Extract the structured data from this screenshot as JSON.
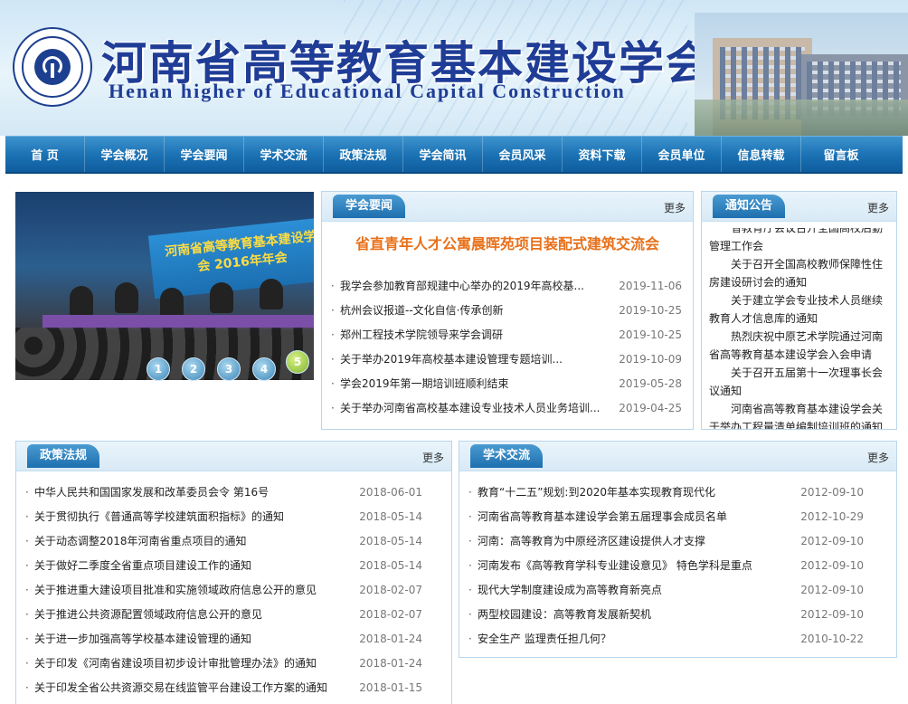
{
  "site": {
    "title": "河南省高等教育基本建设学会",
    "subtitle": "Henan higher of Educational Capital Construction"
  },
  "nav": [
    "首 页",
    "学会概况",
    "学会要闻",
    "学术交流",
    "政策法规",
    "学会简讯",
    "会员风采",
    "资料下载",
    "会员单位",
    "信息转载",
    "留言板"
  ],
  "slider": {
    "banner_text": "河南省高等教育基本建设学会 2016年年会",
    "dots": [
      "1",
      "2",
      "3",
      "4",
      "5"
    ],
    "active_dot": 5
  },
  "more_label": "更多",
  "news": {
    "title": "学会要闻",
    "headline": "省直青年人才公寓晨晖苑项目装配式建筑交流会",
    "items": [
      {
        "title": "我学会参加教育部规建中心举办的2019年高校基...",
        "date": "2019-11-06"
      },
      {
        "title": "杭州会议报道--文化自信·传承创新",
        "date": "2019-10-25"
      },
      {
        "title": "郑州工程技术学院领导来学会调研",
        "date": "2019-10-25"
      },
      {
        "title": "关于举办2019年高校基本建设管理专题培训...",
        "date": "2019-10-09"
      },
      {
        "title": "学会2019年第一期培训班顺利结束",
        "date": "2019-05-28"
      },
      {
        "title": "关于举办河南省高校基本建设专业技术人员业务培训...",
        "date": "2019-04-25"
      }
    ]
  },
  "notice": {
    "title": "通知公告",
    "items": [
      "省教育厅会议召开全国高校后勤管理工作会",
      "关于召开全国高校教师保障性住房建设研讨会的通知",
      "关于建立学会专业技术人员继续教育人才信息库的通知",
      "热烈庆祝中原艺术学院通过河南省高等教育基本建设学会入会申请",
      "关于召开五届第十一次理事长会议通知",
      "河南省高等教育基本建设学会关于举办工程量清单编制培训班的通知"
    ]
  },
  "policy": {
    "title": "政策法规",
    "items": [
      {
        "title": "中华人民共和国国家发展和改革委员会令 第16号",
        "date": "2018-06-01"
      },
      {
        "title": "关于贯彻执行《普通高等学校建筑面积指标》的通知",
        "date": "2018-05-14"
      },
      {
        "title": "关于动态调整2018年河南省重点项目的通知",
        "date": "2018-05-14"
      },
      {
        "title": "关于做好二季度全省重点项目建设工作的通知",
        "date": "2018-05-14"
      },
      {
        "title": "关于推进重大建设项目批准和实施领域政府信息公开的意见",
        "date": "2018-02-07"
      },
      {
        "title": "关于推进公共资源配置领域政府信息公开的意见",
        "date": "2018-02-07"
      },
      {
        "title": "关于进一步加强高等学校基本建设管理的通知",
        "date": "2018-01-24"
      },
      {
        "title": "关于印发《河南省建设项目初步设计审批管理办法》的通知",
        "date": "2018-01-24"
      },
      {
        "title": "关于印发全省公共资源交易在线监管平台建设工作方案的通知",
        "date": "2018-01-15"
      }
    ]
  },
  "academic": {
    "title": "学术交流",
    "items": [
      {
        "title": "教育“十二五”规划:到2020年基本实现教育现代化",
        "date": "2012-09-10"
      },
      {
        "title": "河南省高等教育基本建设学会第五届理事会成员名单",
        "date": "2012-10-29"
      },
      {
        "title": "河南：高等教育为中原经济区建设提供人才支撑",
        "date": "2012-09-10"
      },
      {
        "title": "河南发布《高等教育学科专业建设意见》 特色学科是重点",
        "date": "2012-09-10"
      },
      {
        "title": "现代大学制度建设成为高等教育新亮点",
        "date": "2012-09-10"
      },
      {
        "title": "两型校园建设：高等教育发展新契机",
        "date": "2012-09-10"
      },
      {
        "title": "安全生产 监理责任担几何？",
        "date": "2010-10-22"
      }
    ]
  }
}
